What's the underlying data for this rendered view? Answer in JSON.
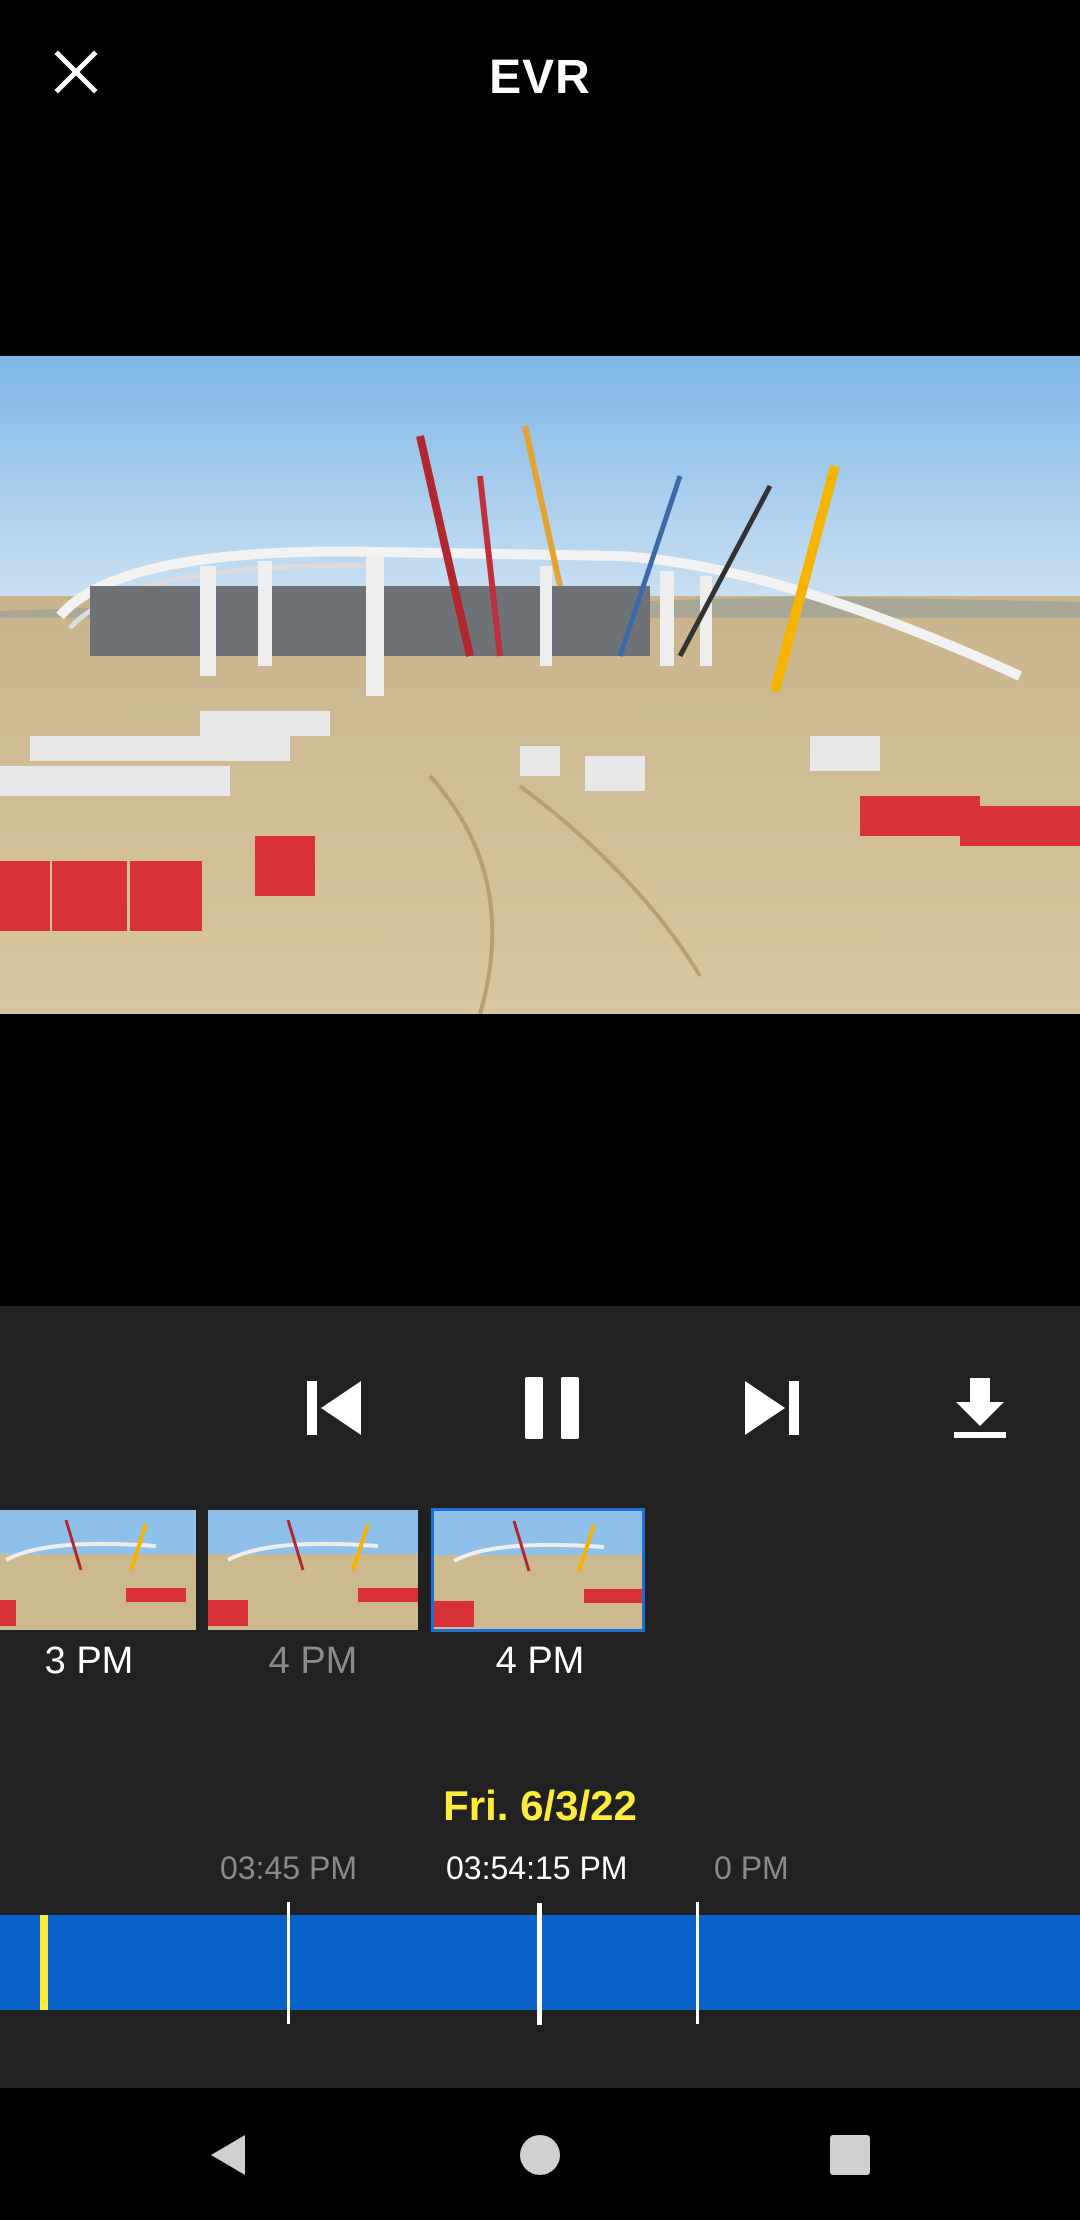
{
  "header": {
    "title": "EVR"
  },
  "icons": {
    "close": "close-icon",
    "previous": "skip-previous-icon",
    "pause": "pause-icon",
    "next": "skip-next-icon",
    "download": "download-icon",
    "back": "nav-back-icon",
    "home": "nav-home-icon",
    "recents": "nav-recents-icon"
  },
  "thumbnails": [
    {
      "label": "3 PM",
      "state": "normal"
    },
    {
      "label": "4 PM",
      "state": "dimmed"
    },
    {
      "label": "4 PM",
      "state": "selected"
    }
  ],
  "timeline": {
    "date": "Fri. 6/3/22",
    "left_time": "03:45 PM",
    "current_time": "03:54:15 PM",
    "right_time": "0 PM"
  },
  "colors": {
    "accent_yellow": "#ffeb3b",
    "timeline_blue": "#0a63c9",
    "panel_bg": "#212121",
    "selected_border": "#1e6fd0"
  }
}
